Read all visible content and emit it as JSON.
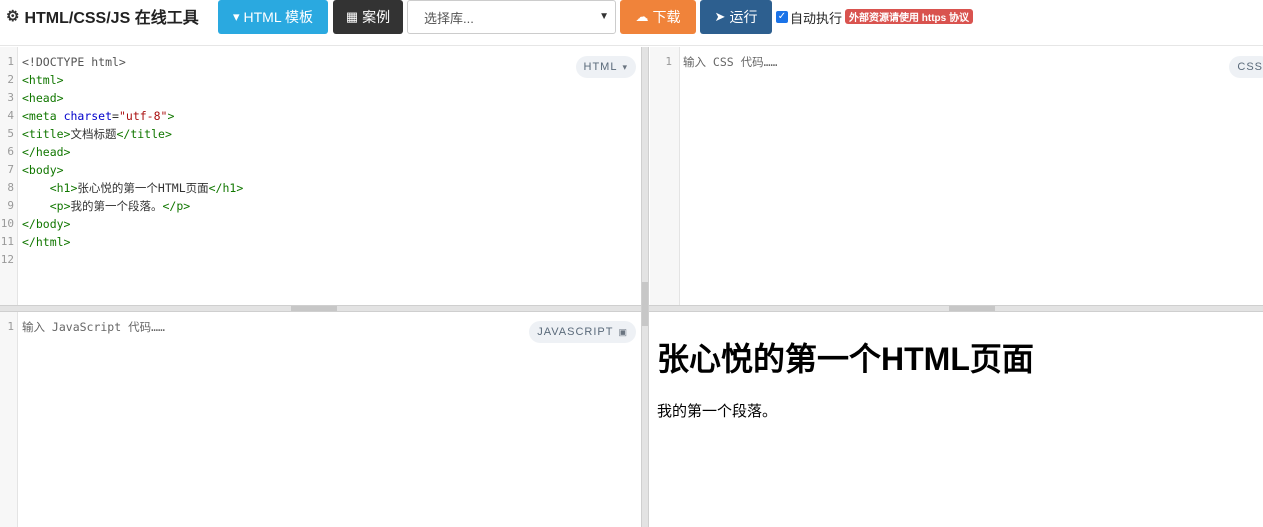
{
  "toolbar": {
    "brand": "HTML/CSS/JS 在线工具",
    "template_label": "HTML 模板",
    "cases_label": "案例",
    "library_placeholder": "选择库...",
    "download_label": "下载",
    "run_label": "运行",
    "auto_run_label": "自动执行",
    "auto_run_checked": true,
    "https_notice": "外部资源请使用 https 协议"
  },
  "html_pane": {
    "label": "HTML",
    "line_numbers": [
      "1",
      "2",
      "3",
      "4",
      "5",
      "6",
      "7",
      "8",
      "9",
      "10",
      "11",
      "12"
    ],
    "lines": [
      "<!DOCTYPE html>",
      "<html>",
      "<head>",
      "<meta charset=\"utf-8\">",
      "<title>文档标题</title>",
      "</head>",
      "<body>",
      "    <h1>张心悦的第一个HTML页面</h1>",
      "    <p>我的第一个段落。</p>",
      "</body>",
      "</html>",
      ""
    ]
  },
  "css_pane": {
    "label": "CSS",
    "line_numbers": [
      "1"
    ],
    "placeholder": "输入 CSS 代码……"
  },
  "js_pane": {
    "label": "JAVASCRIPT",
    "line_numbers": [
      "1"
    ],
    "placeholder": "输入 JavaScript 代码……"
  },
  "preview": {
    "heading": "张心悦的第一个HTML页面",
    "paragraph": "我的第一个段落。"
  },
  "colors": {
    "template_button": "#2aa9e0",
    "cases_button": "#333333",
    "download_button": "#f0833a",
    "run_button": "#2d5f8f",
    "https_badge": "#d9534f"
  },
  "icons": {
    "brand": "gears-icon",
    "template": "html5-icon",
    "cases": "table-icon",
    "download": "cloud-download-icon",
    "run": "paper-plane-icon",
    "select": "chevron-down-icon"
  }
}
